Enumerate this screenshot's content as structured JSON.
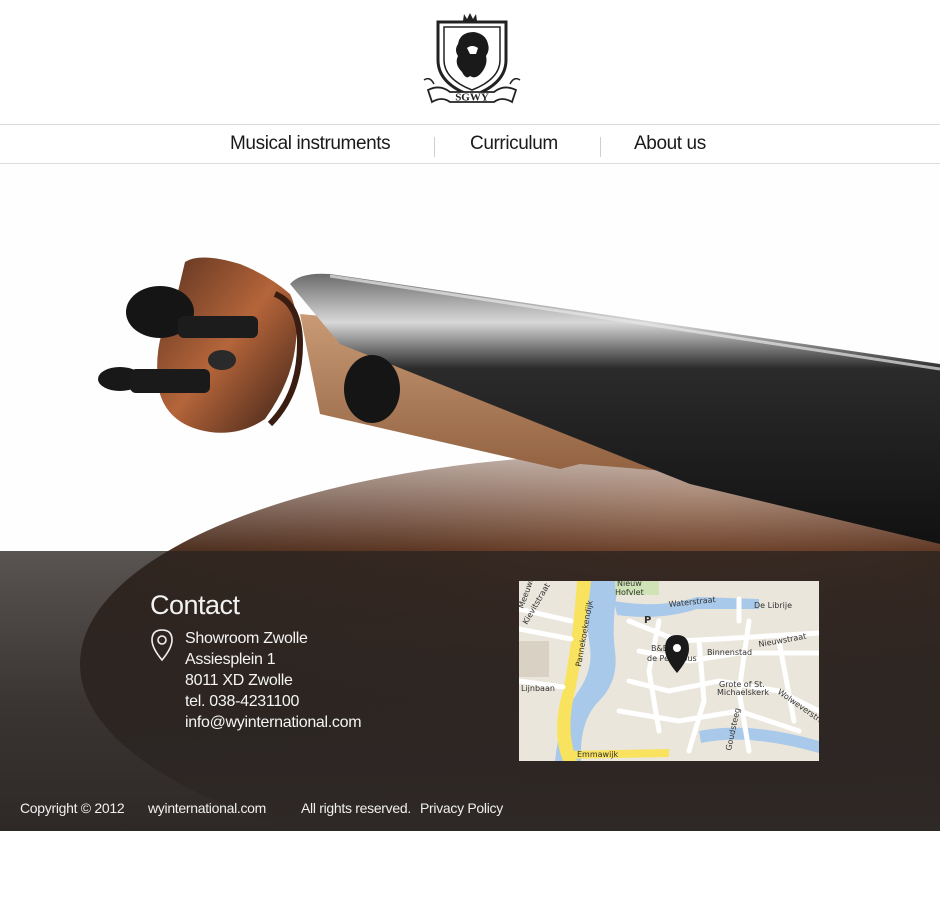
{
  "header": {
    "logo_icon": "lion-crest-shield-icon",
    "logo_text": "SGWY"
  },
  "nav": {
    "items": [
      {
        "label": "Musical instruments"
      },
      {
        "label": "Curriculum"
      },
      {
        "label": "About us"
      }
    ]
  },
  "hero": {
    "image": "violin-scroll-photo"
  },
  "contact": {
    "title": "Contact",
    "icon": "map-pin-icon",
    "lines": [
      "Showroom Zwolle",
      "Assiesplein 1",
      "8011 XD Zwolle",
      "tel. 038-4231100",
      "info@wyinternational.com"
    ]
  },
  "map": {
    "labels": [
      "Waterstraat",
      "De Librije",
      "Nieuw Hofvlet",
      "Pannekoekendijk",
      "Kievitstraat",
      "Meeuwenstraat",
      "Binnenstad",
      "Nieuwstraat",
      "B&B Huize de Peperbus",
      "Grote of St. Michaelskerk",
      "Wolweverstraat",
      "Lijnbaan",
      "Goudsteeg",
      "Emmawijk",
      "P"
    ],
    "colors": {
      "water": "#a9c9ea",
      "land": "#ebe6dc",
      "road": "#ffffff",
      "major_road": "#f9e25e"
    }
  },
  "footer": {
    "copyright": "Copyright © 2012",
    "site": "wyinternational.com",
    "rights": "All rights reserved.",
    "privacy": "Privacy Policy",
    "band_color": "#2e2826"
  }
}
